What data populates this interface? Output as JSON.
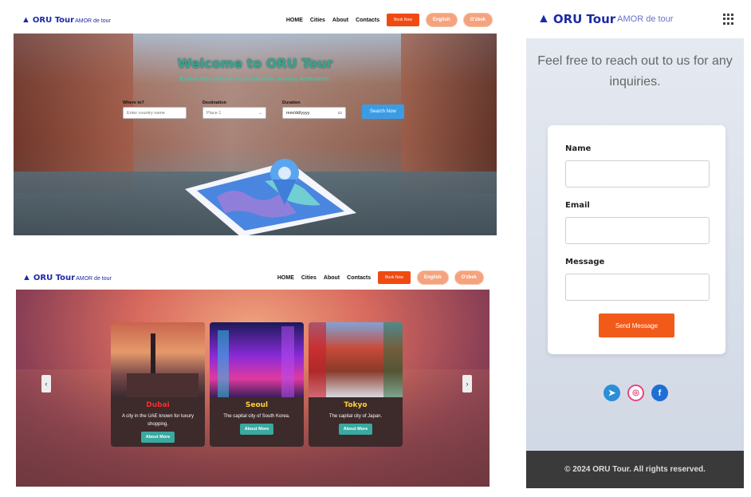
{
  "brand": {
    "name": "ORU Tour",
    "tagline": "AMOR de tour"
  },
  "nav": {
    "links": [
      "HOME",
      "Cities",
      "About",
      "Contacts"
    ],
    "book_now": "Book Now",
    "lang_en": "English",
    "lang_uz": "O'zbek"
  },
  "hero": {
    "title": "Welcome to ORU Tour",
    "subtitle": "Explore the world with us and discover amazing destinations."
  },
  "search": {
    "where_label": "Where to?",
    "where_placeholder": "Enter country name",
    "destination_label": "Destination",
    "destination_value": "Place 1",
    "duration_label": "Duration",
    "date_placeholder": "mm/dd/yyyy",
    "button": "Search Now"
  },
  "cities": [
    {
      "name": "Dubai",
      "description": "A city in the UAE known for luxury shopping.",
      "button": "About More"
    },
    {
      "name": "Seoul",
      "description": "The capital city of South Korea.",
      "button": "About More"
    },
    {
      "name": "Tokyo",
      "description": "The capital city of Japan.",
      "button": "About More"
    }
  ],
  "contact": {
    "intro": "Feel free to reach out to us for any inquiries.",
    "name_label": "Name",
    "email_label": "Email",
    "message_label": "Message",
    "send_button": "Send Message",
    "footer": "© 2024 ORU Tour. All rights reserved."
  },
  "socials": [
    "telegram-icon",
    "instagram-icon",
    "facebook-icon"
  ],
  "colors": {
    "brand": "#1d2aa5",
    "accent": "#f04a12",
    "pill": "#f5a37e",
    "teal": "#3aa99f"
  }
}
